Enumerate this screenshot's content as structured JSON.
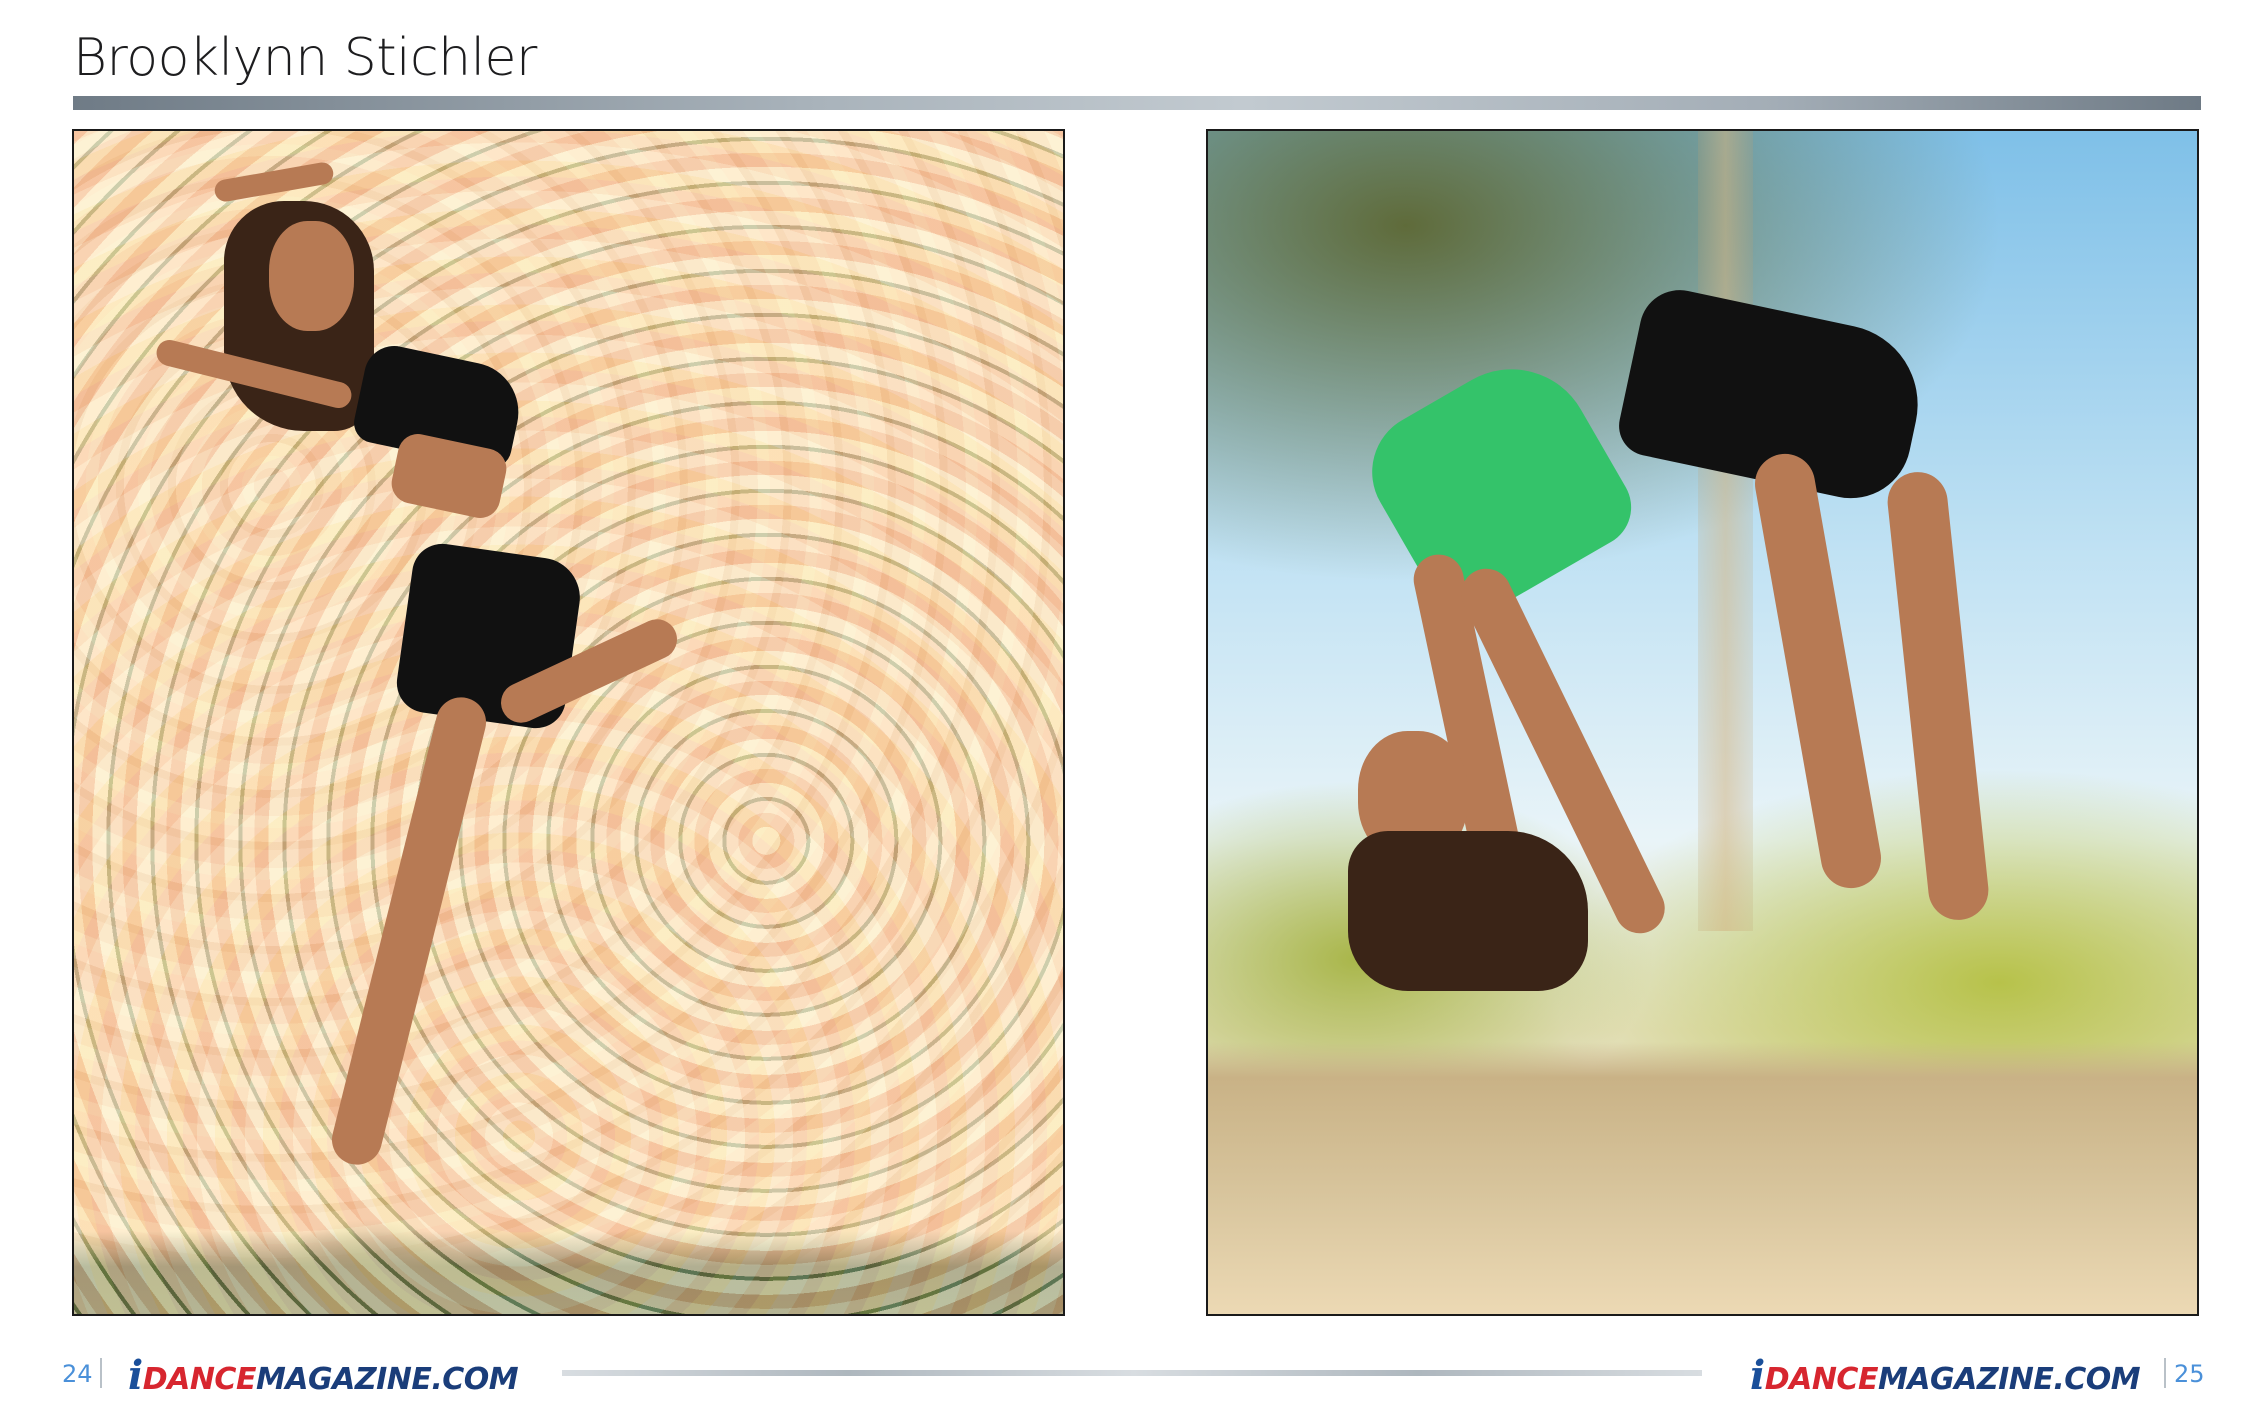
{
  "header": {
    "title": "Brooklynn Stichler"
  },
  "photos": [
    {
      "name": "floral-wall-photo",
      "icon": "photo-image"
    },
    {
      "name": "outdoor-backbend-photo",
      "icon": "photo-image"
    }
  ],
  "footer": {
    "left_page_number": "24",
    "right_page_number": "25",
    "brand_i": "i",
    "brand_dance": "DANCE",
    "brand_magazine": "MAGAZINE.COM"
  },
  "colors": {
    "accent_blue": "#4a90d9",
    "brand_red": "#d7262f",
    "brand_navy": "#1a3d7a",
    "rule_gray": "#8e99a3"
  }
}
